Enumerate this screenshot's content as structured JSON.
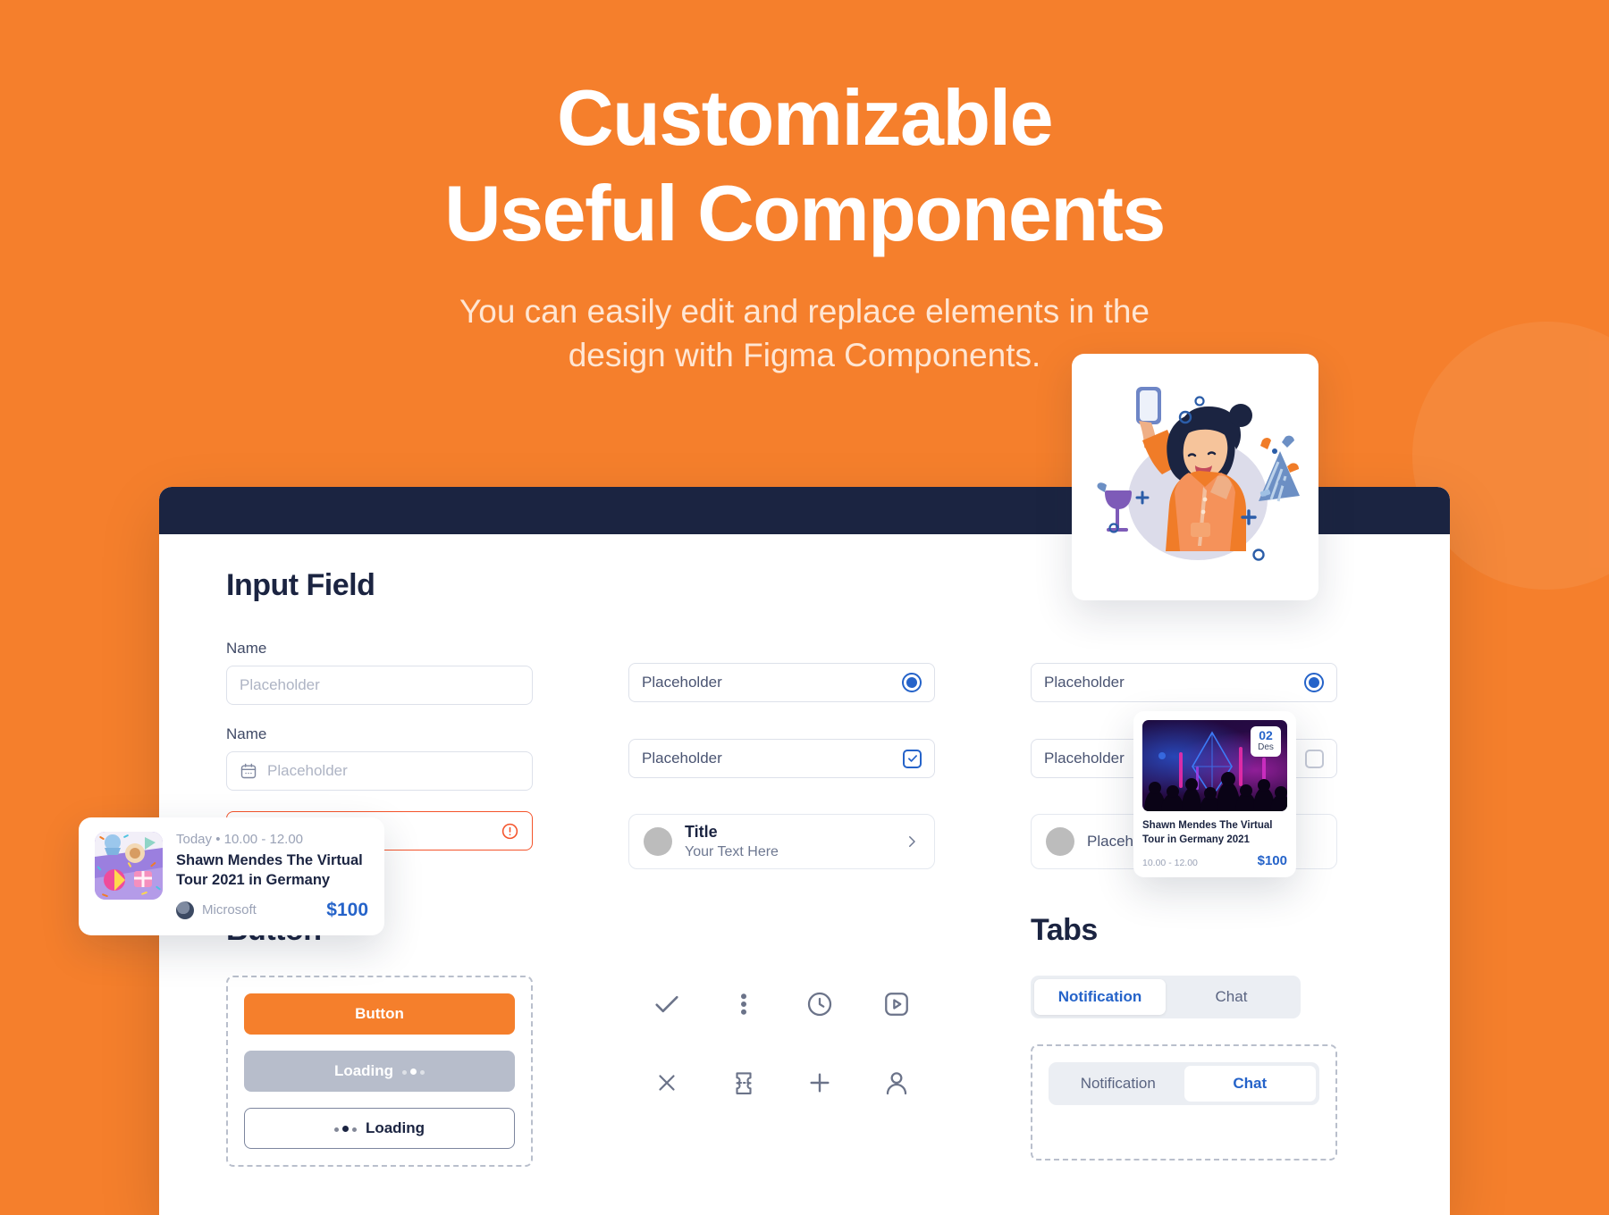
{
  "theme": {
    "brand_orange": "#F57F2C",
    "navy": "#1B2441",
    "blue": "#2563C9",
    "error_red": "#F4542B",
    "gray": "#B7BDCB"
  },
  "hero": {
    "title_line1": "Customizable",
    "title_line2": "Useful Components",
    "subtitle_line1": "You can easily edit and replace elements in the",
    "subtitle_line2": "design with Figma Components."
  },
  "panel": {
    "sections": {
      "input_field": "Input Field",
      "button": "Button",
      "tabs": "Tabs"
    },
    "inputs": {
      "label_name_1": "Name",
      "label_name_2": "Name",
      "placeholder": "Placeholder",
      "calendar_icon": "calendar-icon",
      "error_icon": "error-circle-icon",
      "radio_icon": "radio-selected-icon",
      "checkbox_checked_icon": "checkbox-checked-icon",
      "checkbox_empty_icon": "checkbox-empty-icon",
      "chevron_icon": "chevron-right-icon",
      "list_title": "Title",
      "list_subtitle": "Your Text Here",
      "avatar": "avatar"
    },
    "buttons": {
      "primary": "Button",
      "loading": "Loading",
      "outline_loading": "Loading"
    },
    "icons": [
      "check-icon",
      "more-vertical-icon",
      "clock-icon",
      "play-square-icon",
      "close-icon",
      "ticket-icon",
      "plus-icon",
      "user-icon"
    ],
    "tabs_top": [
      {
        "label": "Notification",
        "active": true
      },
      {
        "label": "Chat",
        "active": false
      }
    ],
    "tabs_bottom": [
      {
        "label": "Notification",
        "active": false
      },
      {
        "label": "Chat",
        "active": true
      }
    ]
  },
  "event_card": {
    "meta": "Today • 10.00 - 12.00",
    "title": "Shawn Mendes The Virtual Tour 2021 in Germany",
    "organizer": "Microsoft",
    "price": "$100",
    "thumb": "party-photo-thumbnail",
    "avatar": "organizer-avatar"
  },
  "concert_card": {
    "badge_day": "02",
    "badge_month": "Des",
    "title": "Shawn Mendes The Virtual Tour in Germany 2021",
    "time": "10.00 - 12.00",
    "price": "$100",
    "image": "concert-crowd-photo"
  },
  "illustration_card": {
    "image": "woman-celebrating-with-phone-illustration"
  }
}
